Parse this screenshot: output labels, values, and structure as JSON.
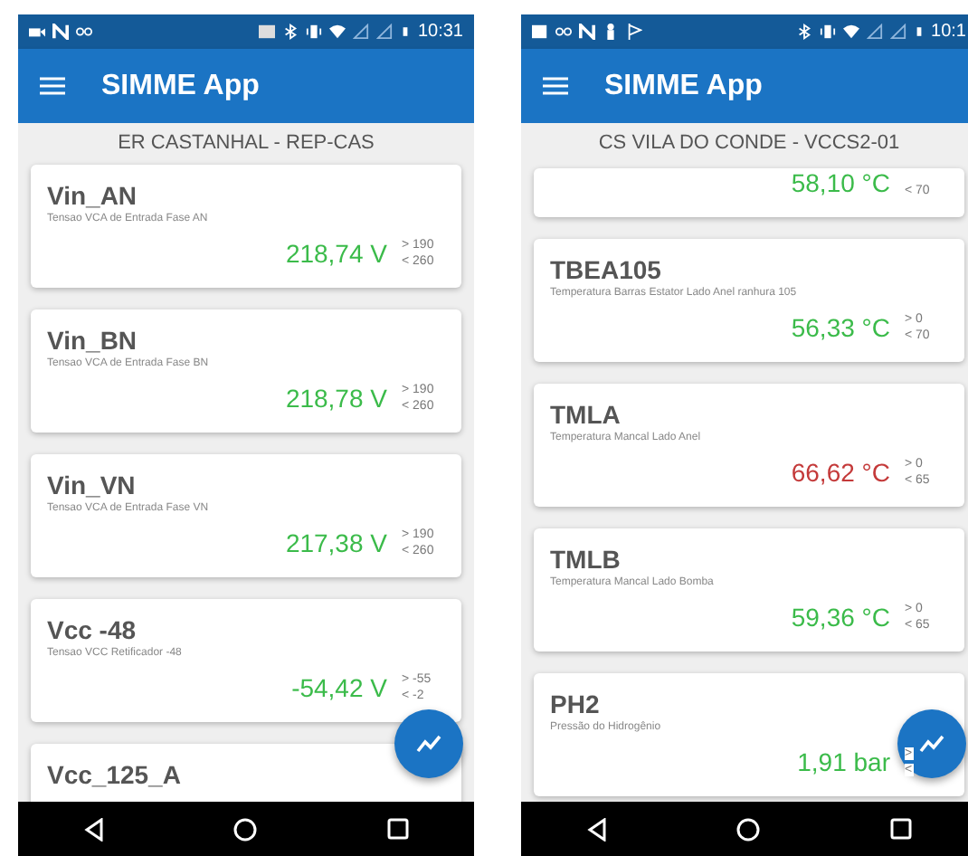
{
  "phones": [
    {
      "status_bar": {
        "time": "10:31"
      },
      "app_bar": {
        "title": "SIMME App"
      },
      "subtitle": "ER CASTANHAL  -  REP-CAS",
      "cards": [
        {
          "name": "Vin_AN",
          "description": "Tensao VCA de Entrada Fase AN",
          "value": "218,74 V",
          "alarm": false,
          "min": "> 190",
          "max": "< 260"
        },
        {
          "name": "Vin_BN",
          "description": "Tensao VCA de Entrada Fase BN",
          "value": "218,78 V",
          "alarm": false,
          "min": "> 190",
          "max": "< 260"
        },
        {
          "name": "Vin_VN",
          "description": "Tensao VCA de Entrada Fase VN",
          "value": "217,38 V",
          "alarm": false,
          "min": "> 190",
          "max": "< 260"
        },
        {
          "name": "Vcc -48",
          "description": "Tensao VCC Retificador -48",
          "value": "-54,42 V",
          "alarm": false,
          "min": "> -55",
          "max": "< -2"
        },
        {
          "name": "Vcc_125_A"
        }
      ]
    },
    {
      "status_bar": {
        "time": "10:1"
      },
      "app_bar": {
        "title": "SIMME App"
      },
      "subtitle": "CS VILA DO CONDE  -  VCCS2-01",
      "cards": [
        {
          "value": "58,10 °C",
          "alarm": false,
          "max": "< 70"
        },
        {
          "name": "TBEA105",
          "description": "Temperatura Barras Estator Lado Anel ranhura 105",
          "value": "56,33 °C",
          "alarm": false,
          "min": "> 0",
          "max": "< 70"
        },
        {
          "name": "TMLA",
          "description": "Temperatura Mancal Lado Anel",
          "value": "66,62 °C",
          "alarm": true,
          "min": "> 0",
          "max": "< 65"
        },
        {
          "name": "TMLB",
          "description": "Temperatura Mancal Lado Bomba",
          "value": "59,36 °C",
          "alarm": false,
          "min": "> 0",
          "max": "< 65"
        },
        {
          "name": "PH2",
          "description": "Pressão do Hidrogênio",
          "value": "1,91 bar",
          "alarm": false,
          "min": ">",
          "max": "<"
        }
      ]
    }
  ]
}
